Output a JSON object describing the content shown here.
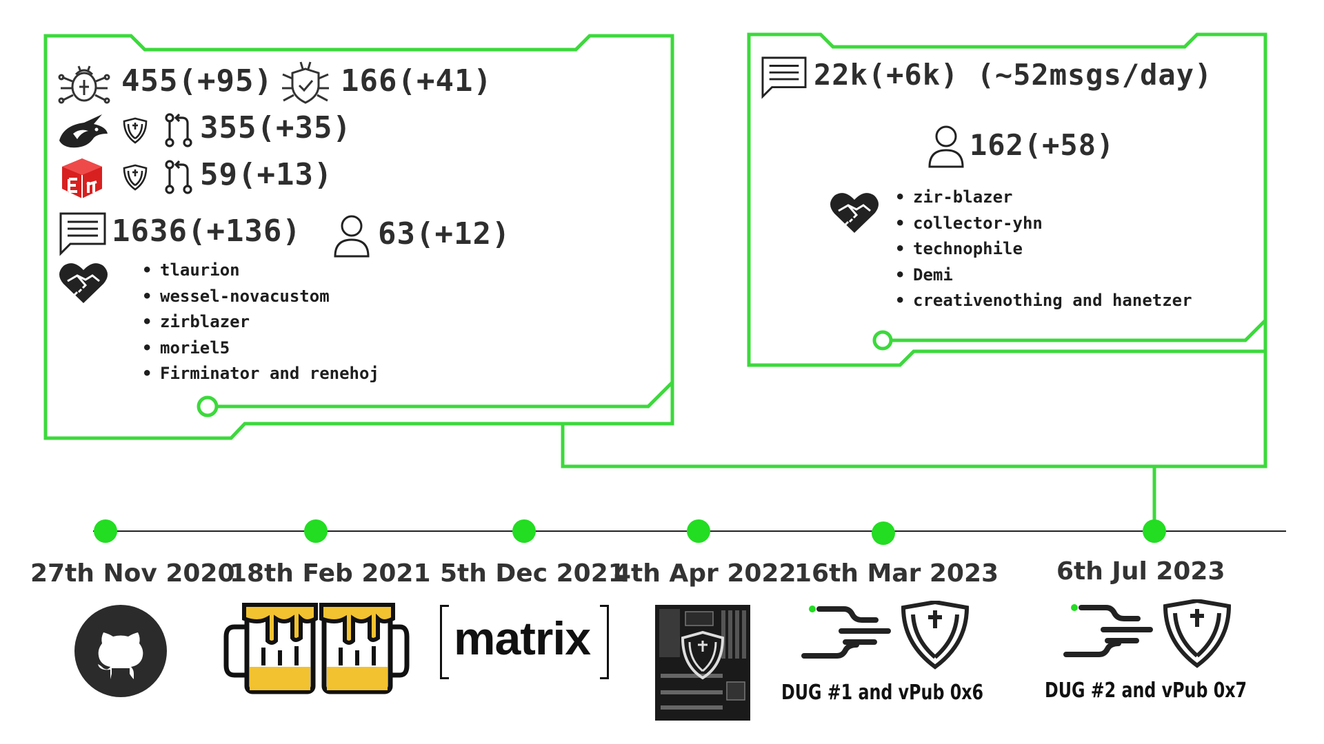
{
  "colors": {
    "accent": "#3cd93c",
    "dot": "#22dd22",
    "ink": "#2b2b2b",
    "red": "#d82020",
    "gold": "#f2c230"
  },
  "left_panel": {
    "issues_open": "455(+95)",
    "issues_closed": "166(+41)",
    "coreboot_prs": "355(+35)",
    "edk2_prs": "59(+13)",
    "messages": "1636(+136)",
    "users": "63(+12)",
    "contributors": [
      "tlaurion",
      "wessel-novacustom",
      "zirblazer",
      "moriel5",
      "Firminator and renehoj"
    ]
  },
  "right_panel": {
    "messages": "22k(+6k) (~52msgs/day)",
    "users": "162(+58)",
    "contributors": [
      "zir-blazer",
      "collector-yhn",
      "technophile",
      "Demi",
      "creativenothing and hanetzer"
    ]
  },
  "timeline": {
    "events": [
      {
        "date": "27th Nov 2020",
        "icon": "github-icon"
      },
      {
        "date": "18th Feb 2021",
        "icon": "beer-mugs-icon"
      },
      {
        "date": "5th Dec 2021",
        "icon": "matrix-logo",
        "logo_text": "matrix"
      },
      {
        "date": "4th Apr 2022",
        "icon": "motherboard-icon"
      },
      {
        "date": "16th Mar 2023",
        "icon": "dug-logo",
        "caption": "DUG #1 and vPub 0x6"
      },
      {
        "date": "6th Jul 2023",
        "icon": "dug-logo",
        "caption": "DUG #2 and vPub 0x7"
      }
    ]
  }
}
